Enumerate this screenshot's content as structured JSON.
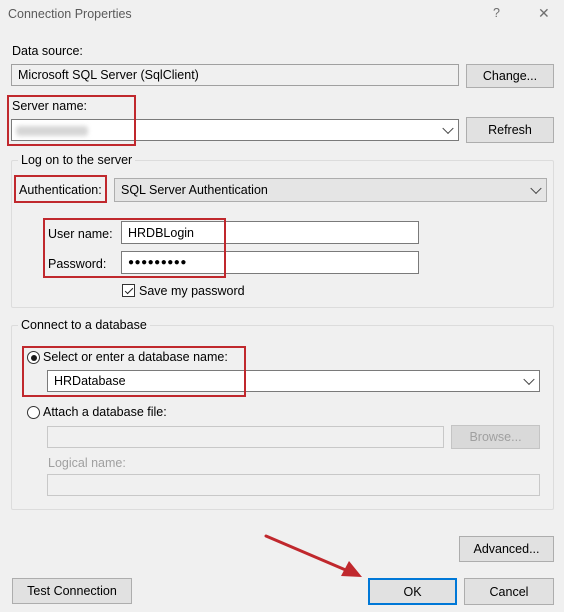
{
  "window": {
    "title": "Connection Properties",
    "help_glyph": "?",
    "close_glyph": "✕"
  },
  "data_source": {
    "label": "Data source:",
    "value": "Microsoft SQL Server (SqlClient)",
    "change_button": "Change..."
  },
  "server": {
    "label": "Server name:",
    "value": "",
    "refresh_button": "Refresh"
  },
  "logon": {
    "group_label": "Log on to the server",
    "auth_label": "Authentication:",
    "auth_value": "SQL Server Authentication",
    "username_label": "User name:",
    "username_value": "HRDBLogin",
    "password_label": "Password:",
    "password_value": "●●●●●●●●●",
    "save_password_label": "Save my password",
    "save_password_checked": true
  },
  "database": {
    "group_label": "Connect to a database",
    "select_option_label": "Select or enter a database name:",
    "select_option_value": "HRDatabase",
    "attach_option_label": "Attach a database file:",
    "attach_file_value": "",
    "browse_button": "Browse...",
    "logical_name_label": "Logical name:",
    "logical_name_value": ""
  },
  "footer": {
    "advanced_button": "Advanced...",
    "test_connection_button": "Test Connection",
    "ok_button": "OK",
    "cancel_button": "Cancel"
  },
  "colors": {
    "annotation_red": "#c0282d",
    "focus_blue": "#0078d7",
    "background": "#f0f0f0"
  }
}
